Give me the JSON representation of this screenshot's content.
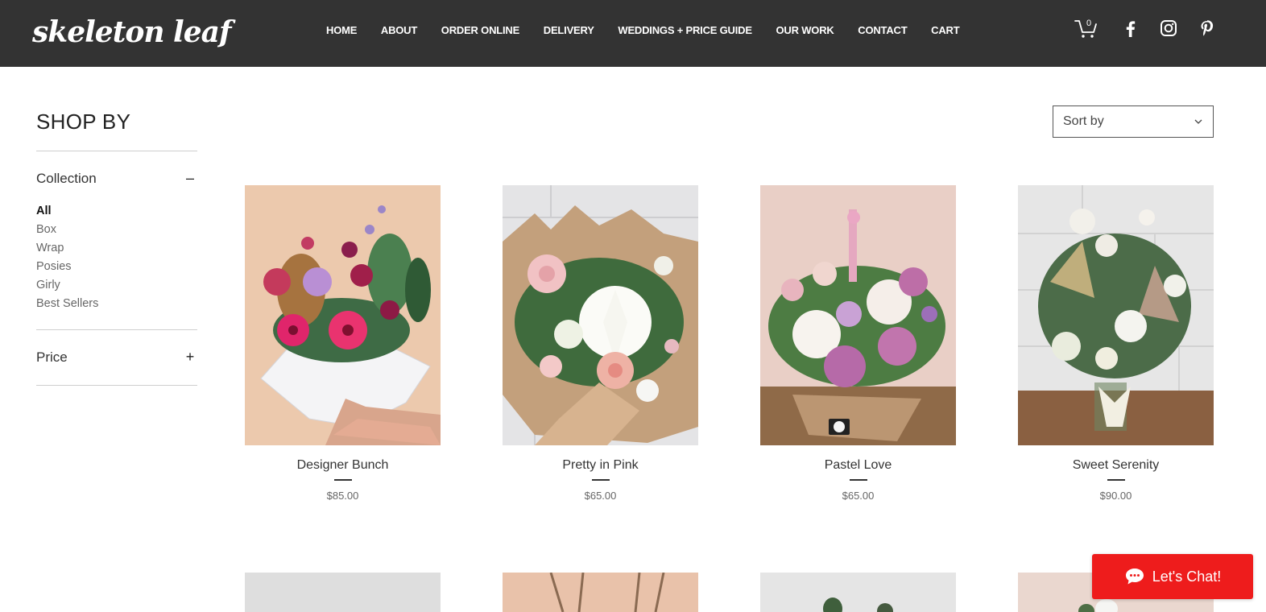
{
  "brand": {
    "logo": "skeleton leaf"
  },
  "nav": [
    "HOME",
    "ABOUT",
    "ORDER ONLINE",
    "DELIVERY",
    "WEDDINGS + PRICE GUIDE",
    "OUR WORK",
    "CONTACT",
    "CART"
  ],
  "header_icons": {
    "cart_count": "0",
    "icons": [
      "cart-icon",
      "facebook-icon",
      "instagram-icon",
      "pinterest-icon"
    ]
  },
  "sidebar": {
    "title": "SHOP BY",
    "collection": {
      "title": "Collection",
      "toggle": "–",
      "items": [
        "All",
        "Box",
        "Wrap",
        "Posies",
        "Girly",
        "Best Sellers"
      ],
      "active": "All"
    },
    "price": {
      "title": "Price",
      "toggle": "+"
    }
  },
  "sort": {
    "label": "Sort by"
  },
  "products": [
    {
      "name": "Designer Bunch",
      "price": "$85.00"
    },
    {
      "name": "Pretty in Pink",
      "price": "$65.00"
    },
    {
      "name": "Pastel Love",
      "price": "$65.00"
    },
    {
      "name": "Sweet Serenity",
      "price": "$90.00"
    }
  ],
  "chat": {
    "label": "Let's Chat!",
    "color": "#ee1c1c"
  },
  "colors": {
    "header_bg": "#333333",
    "text": "#2b2b2b"
  }
}
